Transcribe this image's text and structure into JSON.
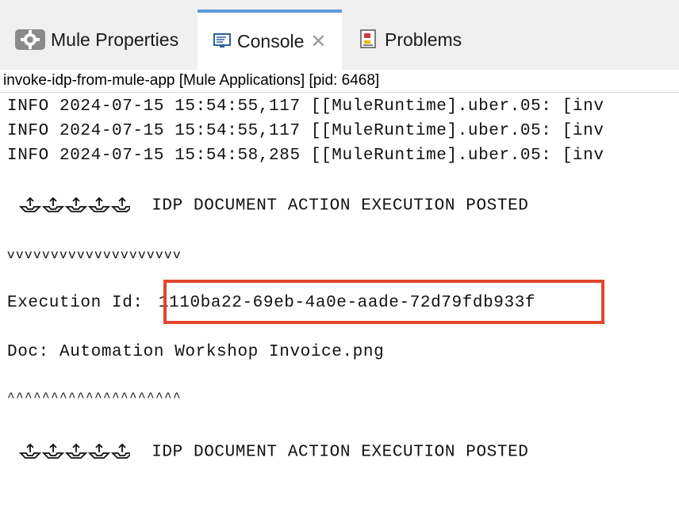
{
  "tabs": [
    {
      "label": "Mule Properties",
      "icon": "gear-icon"
    },
    {
      "label": "Console",
      "icon": "monitor-icon",
      "active": true,
      "closable": true
    },
    {
      "label": "Problems",
      "icon": "problems-icon"
    }
  ],
  "process_label": "invoke-idp-from-mule-app [Mule Applications]  [pid: 6468]",
  "log_lines": [
    "INFO  2024-07-15 15:54:55,117 [[MuleRuntime].uber.05: [inv",
    "INFO  2024-07-15 15:54:55,117 [[MuleRuntime].uber.05: [inv",
    "INFO  2024-07-15 15:54:58,285 [[MuleRuntime].uber.05: [inv"
  ],
  "posted_message": "IDP DOCUMENT ACTION EXECUTION POSTED",
  "posted_icon": "upload-tray-icon",
  "down_arrows": "vvvvvvvvvvvvvvvvvvvv",
  "execution_label": "Execution Id:",
  "execution_id": "1110ba22-69eb-4a0e-aade-72d79fdb933f",
  "doc_line": "Doc: Automation Workshop Invoice.png",
  "up_arrows": "^^^^^^^^^^^^^^^^^^^^",
  "colors": {
    "highlight": "#e2452b",
    "active_tab_border": "#5b9bd5",
    "tab_bar_bg": "#f0f0f0"
  }
}
